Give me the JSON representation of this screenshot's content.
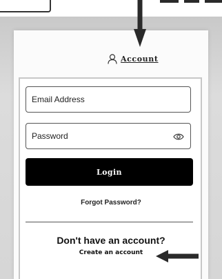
{
  "header": {
    "account_label": "Account"
  },
  "login_form": {
    "email_placeholder": "Email Address",
    "password_placeholder": "Password",
    "login_label": "Login",
    "forgot_password_label": "Forgot Password?",
    "no_account_text": "Don't have an account?",
    "create_account_label": "Create an account"
  },
  "icons": {
    "account": "user-icon",
    "password_visibility": "eye-icon",
    "annotation_down": "arrow-down-icon",
    "annotation_left": "arrow-left-icon"
  },
  "colors": {
    "login_button": "#000000",
    "annotation_arrow": "#2a2a2a",
    "backdrop": "#d3d3d3"
  }
}
